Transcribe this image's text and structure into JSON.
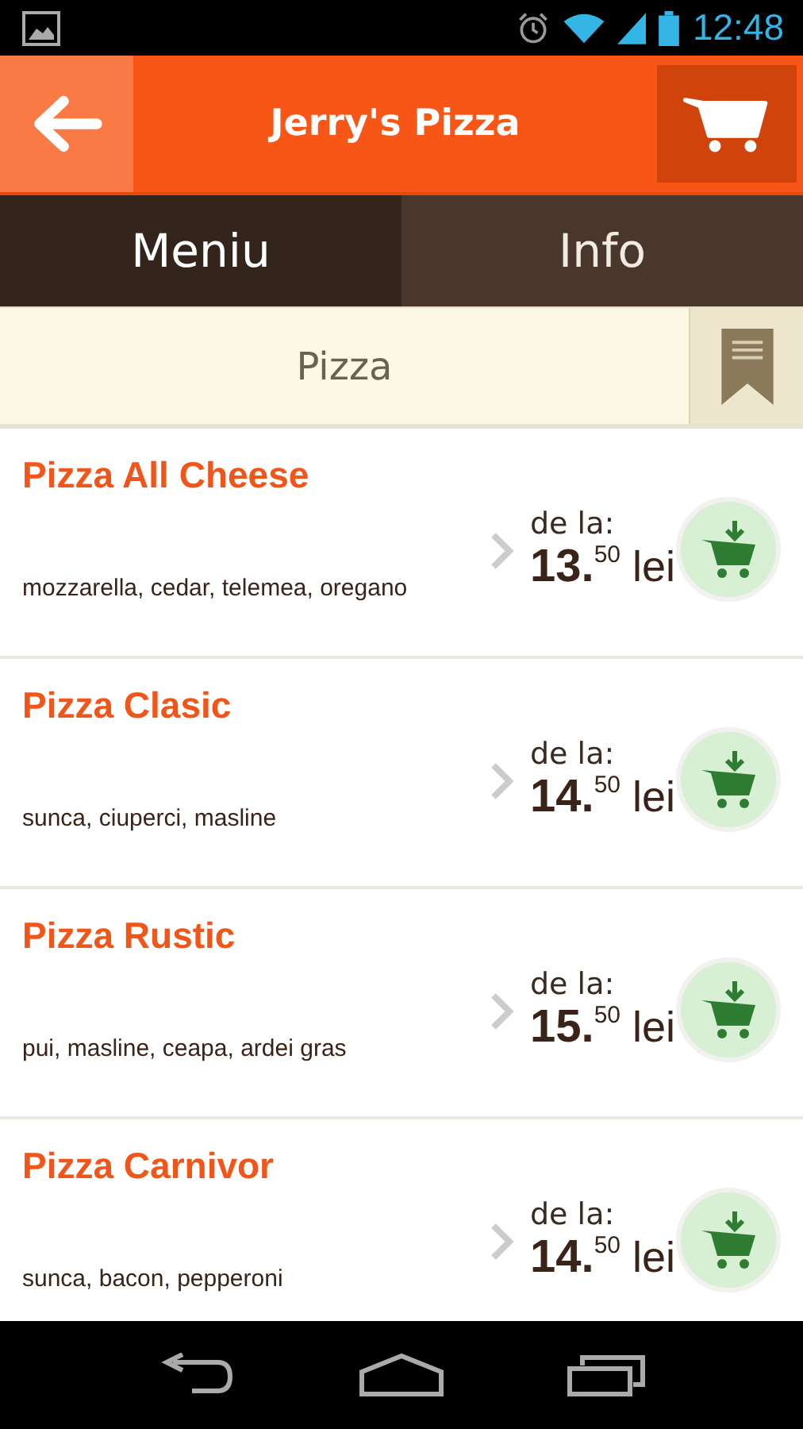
{
  "status_bar": {
    "time": "12:48"
  },
  "header": {
    "title": "Jerry's Pizza"
  },
  "tabs": [
    {
      "label": "Meniu",
      "selected": true
    },
    {
      "label": "Info",
      "selected": false
    }
  ],
  "category": {
    "label": "Pizza"
  },
  "items": [
    {
      "name": "Pizza All Cheese",
      "ingredients": "mozzarella, cedar, telemea, oregano",
      "price_prefix": "de la:",
      "price": "**13.**$^{50}$ lei"
    },
    {
      "name": "Pizza Clasic",
      "ingredients": "sunca, ciuperci, masline",
      "price_prefix": "de la:",
      "price": "**14.**$^{50}$ lei"
    },
    {
      "name": "Pizza Rustic",
      "ingredients": "pui, masline, ceapa, ardei gras",
      "price_prefix": "de la:",
      "price": "**15.**$^{50}$ lei"
    },
    {
      "name": "Pizza Carnivor",
      "ingredients": "sunca, bacon, pepperoni",
      "price_prefix": "de la:",
      "price": "**14.**$^{50}$ lei"
    }
  ]
}
